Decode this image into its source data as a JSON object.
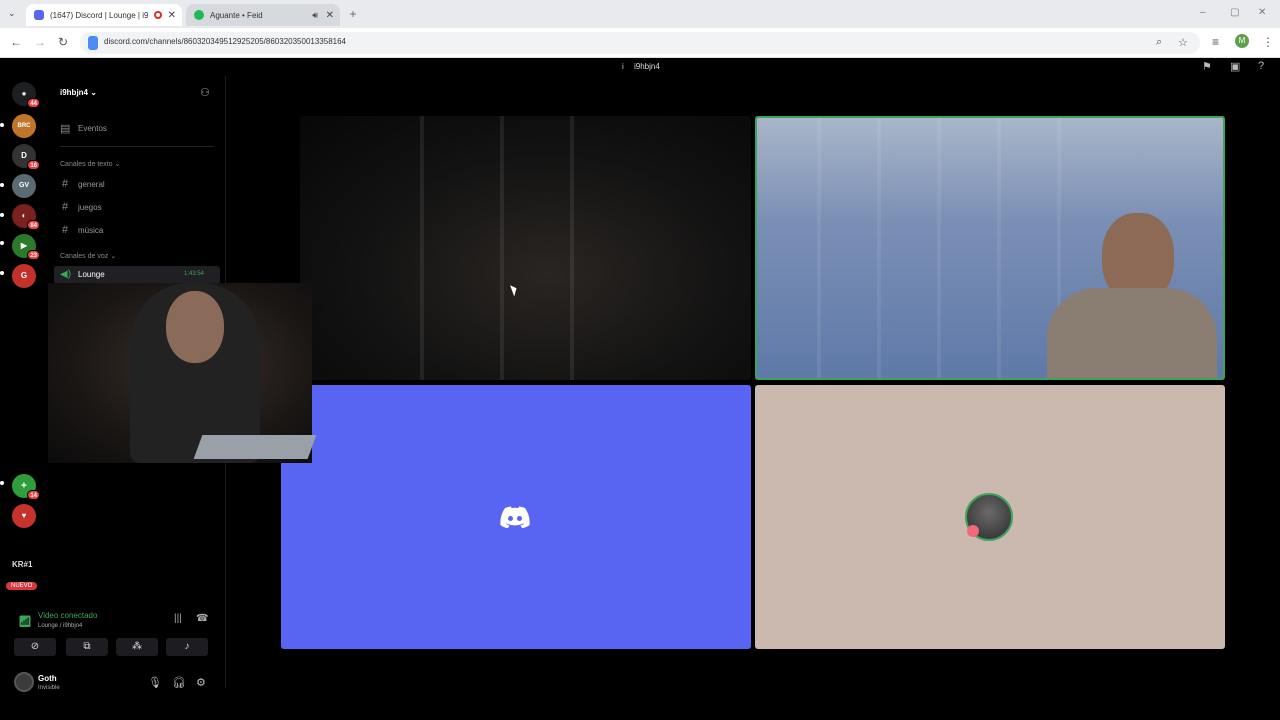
{
  "browser": {
    "tabs": [
      {
        "title": "(1647) Discord | Lounge | i9",
        "active": true
      },
      {
        "title": "Aguante • Feid",
        "active": false
      }
    ],
    "url": "discord.com/channels/860320349512925205/860320350013358164",
    "profile_initial": "M"
  },
  "app": {
    "window_title": "i9hbjn4"
  },
  "guilds": [
    {
      "badge": "44"
    },
    {
      "label": "BRC"
    },
    {
      "badge": "16"
    },
    {
      "label": "GV"
    },
    {
      "badge": "84"
    },
    {
      "badge": "23"
    },
    {
      "badge": ""
    },
    {
      "badge": "14"
    },
    {
      "badge": ""
    }
  ],
  "guild_labels": {
    "kr": "KR#1",
    "new": "NUEVO"
  },
  "sidebar": {
    "server_name": "i9hbjn4",
    "events": "Eventos",
    "text_header": "Canales de texto",
    "text_channels": [
      "general",
      "juegos",
      "música"
    ],
    "voice_header": "Canales de voz",
    "voice_channel": "Lounge",
    "voice_time": "1:43:54"
  },
  "rtc": {
    "status": "Video conectado",
    "location": "Lounge / i9hbjn4"
  },
  "user": {
    "name": "Goth",
    "status": "Invisible"
  },
  "colors": {
    "accent_green": "#3ba55d",
    "blurple": "#5865f2",
    "tile_beige": "#cbb8ae"
  }
}
